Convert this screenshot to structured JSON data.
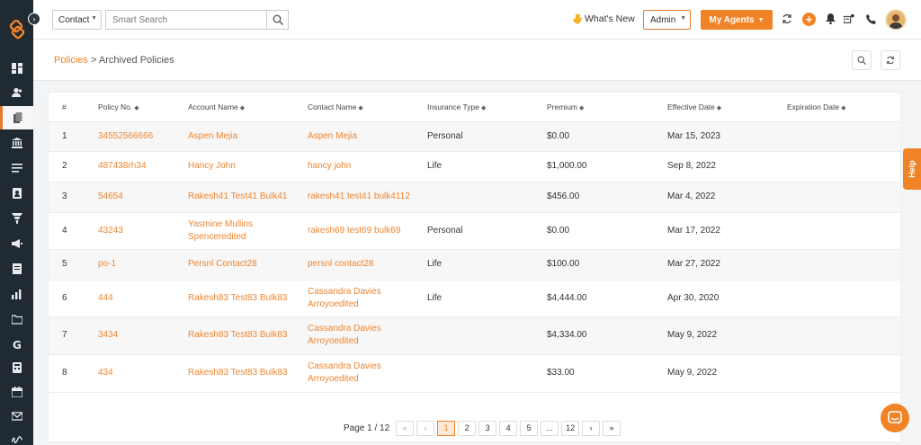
{
  "header": {
    "contact_select": "Contact",
    "search_placeholder": "Smart Search",
    "whats_new": "What's New",
    "admin_select": "Admin",
    "my_agents": "My Agents"
  },
  "page": {
    "breadcrumb_parent": "Policies",
    "breadcrumb_separator": ">",
    "breadcrumb_current": "Archived Policies"
  },
  "table": {
    "columns": [
      "#",
      "Policy No.",
      "Account Name",
      "Contact Name",
      "Insurance Type",
      "Premium",
      "Effective Date",
      "Expiration Date"
    ],
    "rows": [
      {
        "num": "1",
        "policy": "34552566666",
        "account": "Aspen Mejia",
        "contact": "Aspen Mejia",
        "type": "Personal",
        "premium": "$0.00",
        "effective": "Mar 15, 2023",
        "expiration": ""
      },
      {
        "num": "2",
        "policy": "487438rh34",
        "account": "Hancy John",
        "contact": "hancy john",
        "type": "Life",
        "premium": "$1,000.00",
        "effective": "Sep 8, 2022",
        "expiration": ""
      },
      {
        "num": "3",
        "policy": "54654",
        "account": "Rakesh41 Test41 Bulk41",
        "contact": "rakesh41 test41 bulk4112",
        "type": "",
        "premium": "$456.00",
        "effective": "Mar 4, 2022",
        "expiration": ""
      },
      {
        "num": "4",
        "policy": "43243",
        "account": "Yasmine Mullins Spencer",
        "account_suffix": "edited",
        "contact": "rakesh69 test69 bulk69",
        "type": "Personal",
        "premium": "$0.00",
        "effective": "Mar 17, 2022",
        "expiration": ""
      },
      {
        "num": "5",
        "policy": "po-1",
        "account": "Persnl Contact28",
        "contact": "persnl contact28",
        "type": "Life",
        "premium": "$100.00",
        "effective": "Mar 27, 2022",
        "expiration": ""
      },
      {
        "num": "6",
        "policy": "444",
        "account": "Rakesh83 Test83 Bulk83",
        "contact": "Cassandra Davies Arroyo",
        "contact_suffix": "edited",
        "type": "Life",
        "premium": "$4,444.00",
        "effective": "Apr 30, 2020",
        "expiration": ""
      },
      {
        "num": "7",
        "policy": "3434",
        "account": "Rakesh83 Test83 Bulk83",
        "contact": "Cassandra Davies Arroyo",
        "contact_suffix": "edited",
        "type": "",
        "premium": "$4,334.00",
        "effective": "May 9, 2022",
        "expiration": ""
      },
      {
        "num": "8",
        "policy": "434",
        "account": "Rakesh83 Test83 Bulk83",
        "contact": "Cassandra Davies Arroyo",
        "contact_suffix": "edited",
        "type": "",
        "premium": "$33.00",
        "effective": "May 9, 2022",
        "expiration": ""
      }
    ]
  },
  "pagination": {
    "label": "Page 1 / 12",
    "first": "«",
    "prev": "‹",
    "pages": [
      "1",
      "2",
      "3",
      "4",
      "5",
      "...",
      "12"
    ],
    "next": "›",
    "last": "»",
    "current": "1"
  },
  "help": {
    "label": "Help"
  },
  "colors": {
    "accent": "#f08326",
    "sidebar": "#1f2a33"
  },
  "icons": {
    "sidebar": [
      "dashboard-icon",
      "contacts-icon",
      "policies-icon",
      "bank-icon",
      "list-icon",
      "address-book-icon",
      "funnel-icon",
      "megaphone-icon",
      "document-icon",
      "bar-chart-icon",
      "folder-icon",
      "google-icon",
      "calculator-icon",
      "calendar-icon",
      "email-icon",
      "signature-icon"
    ]
  }
}
